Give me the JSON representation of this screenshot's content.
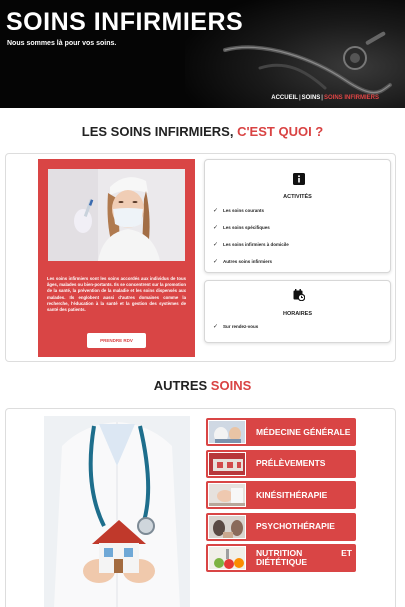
{
  "header": {
    "title": "SOINS INFIRMIERS",
    "tagline": "Nous sommes là pour vos soins.",
    "breadcrumb": {
      "home": "ACCUEIL",
      "sep1": "|",
      "soins": "SOINS",
      "sep2": "|",
      "current": "SOINS INFIRMIERS"
    }
  },
  "section1": {
    "title_main": "LES SOINS INFIRMIERS,",
    "title_accent": "C'EST QUOI ?",
    "description": "Les soins infirmiers sont les soins accordés aux individus de tous âges, malades ou bien-portants. Ils se concentrent sur la promotion de la santé, la prévention de la maladie et les soins dispensés aux malades. Ils englobent aussi d'autres domaines comme la recherche, l'éducation à la santé et la gestion des systèmes de santé des patients.",
    "button_label": "PRENDRE RDV",
    "activites": {
      "icon": "info-icon",
      "title": "ACTIVITÉS",
      "items": [
        "Les soins courants",
        "Les soins spécifiques",
        "Les soins infirmiers à domicile",
        "Autres soins infirmiers"
      ]
    },
    "horaires": {
      "icon": "clock-calendar-icon",
      "title": "HORAIRES",
      "items": [
        "Sur rendez-vous"
      ]
    }
  },
  "section2": {
    "title_main": "AUTRES",
    "title_accent": "SOINS",
    "items": [
      {
        "label": "MÉDECINE GÉNÉRALE",
        "thumb": "consultation-thumb"
      },
      {
        "label": "PRÉLÈVEMENTS",
        "thumb": "sample-thumb"
      },
      {
        "label": "KINÉSITHÉRAPIE",
        "thumb": "physio-thumb"
      },
      {
        "label": "PSYCHOTHÉRAPIE",
        "thumb": "therapy-thumb"
      },
      {
        "label": "NUTRITION ET DIÉTÉTIQUE",
        "thumb": "nutrition-thumb"
      }
    ]
  },
  "colors": {
    "accent": "#d94545",
    "header_bg": "#050505"
  }
}
